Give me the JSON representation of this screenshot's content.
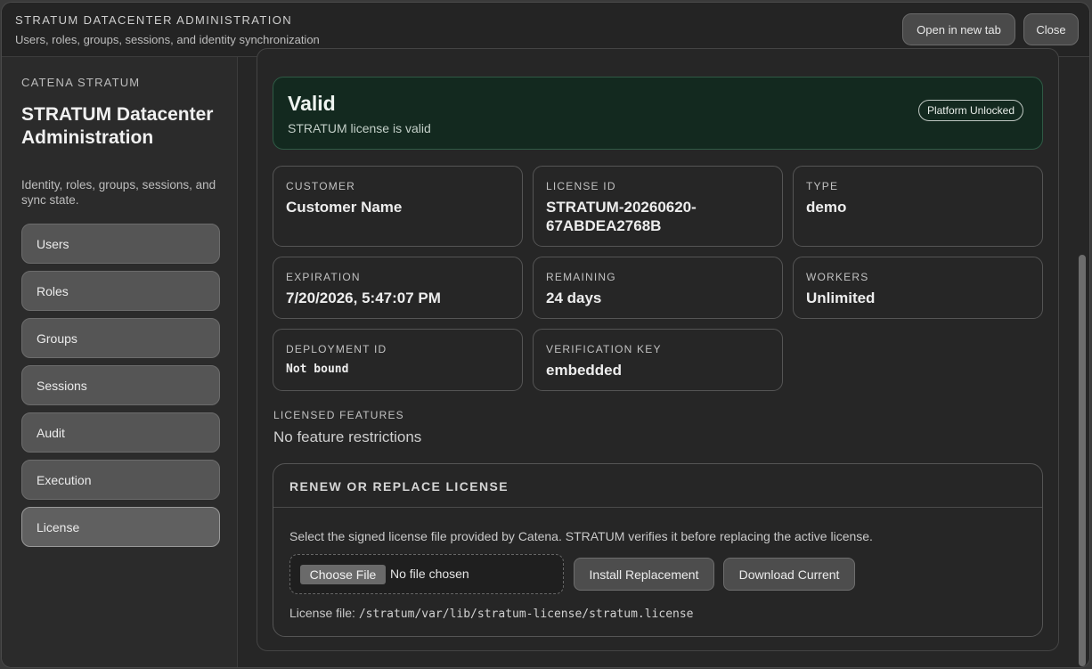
{
  "header": {
    "title": "STRATUM DATACENTER ADMINISTRATION",
    "subtitle": "Users, roles, groups, sessions, and identity synchronization",
    "open_new_tab_label": "Open in new tab",
    "close_label": "Close"
  },
  "sidebar": {
    "eyebrow": "CATENA STRATUM",
    "title": "STRATUM Datacenter Administration",
    "description": "Identity, roles, groups, sessions, and sync state.",
    "items": [
      {
        "label": "Users"
      },
      {
        "label": "Roles"
      },
      {
        "label": "Groups"
      },
      {
        "label": "Sessions"
      },
      {
        "label": "Audit"
      },
      {
        "label": "Execution"
      },
      {
        "label": "License",
        "active": true
      }
    ]
  },
  "license": {
    "status_title": "Valid",
    "status_text": "STRATUM license is valid",
    "badge": "Platform Unlocked",
    "status_color": "#13291f",
    "cards": {
      "customer": {
        "label": "CUSTOMER",
        "value": "Customer Name"
      },
      "license_id": {
        "label": "LICENSE ID",
        "value": "STRATUM-20260620-67ABDEA2768B"
      },
      "type": {
        "label": "TYPE",
        "value": "demo"
      },
      "expiration": {
        "label": "EXPIRATION",
        "value": "7/20/2026, 5:47:07 PM"
      },
      "remaining": {
        "label": "REMAINING",
        "value": "24 days"
      },
      "workers": {
        "label": "WORKERS",
        "value": "Unlimited"
      },
      "deployment_id": {
        "label": "DEPLOYMENT ID",
        "value": "Not bound"
      },
      "verification_key": {
        "label": "VERIFICATION KEY",
        "value": "embedded"
      }
    },
    "features_label": "LICENSED FEATURES",
    "features_value": "No feature restrictions"
  },
  "renew": {
    "title": "RENEW OR REPLACE LICENSE",
    "description": "Select the signed license file provided by Catena. STRATUM verifies it before replacing the active license.",
    "choose_file_label": "Choose File",
    "no_file_label": "No file chosen",
    "install_label": "Install Replacement",
    "download_label": "Download Current",
    "file_prefix": "License file:",
    "file_path": "/stratum/var/lib/stratum-license/stratum.license"
  }
}
